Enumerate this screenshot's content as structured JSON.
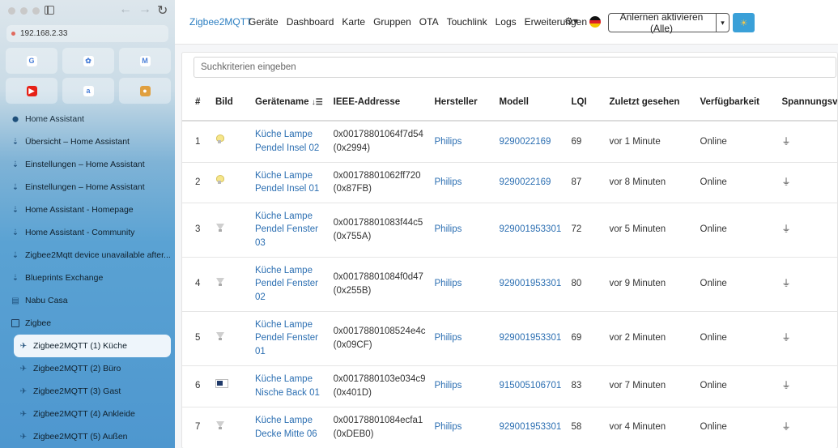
{
  "browser": {
    "url": "192.168.2.33",
    "favorites": [
      {
        "icon": "google-icon",
        "color": "#ffffff",
        "glyph": "G"
      },
      {
        "icon": "photos-icon",
        "color": "#ffffff",
        "glyph": "✿"
      },
      {
        "icon": "gmail-icon",
        "color": "#ffffff",
        "glyph": "M"
      },
      {
        "icon": "youtube-icon",
        "color": "#e62117",
        "glyph": "▶"
      },
      {
        "icon": "amazon-icon",
        "color": "#ffffff",
        "glyph": "a"
      },
      {
        "icon": "placeholder-icon",
        "color": "#e0a040",
        "glyph": "●"
      }
    ],
    "sidebar": {
      "items": [
        {
          "label": "Home Assistant",
          "icon": "home-assistant-icon",
          "kind": "header"
        },
        {
          "label": "Übersicht – Home Assistant",
          "icon": "home-assistant-icon"
        },
        {
          "label": "Einstellungen – Home Assistant",
          "icon": "home-assistant-icon"
        },
        {
          "label": "Einstellungen – Home Assistant",
          "icon": "home-assistant-icon"
        },
        {
          "label": "Home Assistant - Homepage",
          "icon": "home-assistant-icon"
        },
        {
          "label": "Home Assistant - Community",
          "icon": "home-assistant-icon"
        },
        {
          "label": "Zigbee2Mqtt device unavailable after...",
          "icon": "home-assistant-icon"
        },
        {
          "label": "Blueprints Exchange",
          "icon": "home-assistant-icon"
        },
        {
          "label": "Nabu Casa",
          "icon": "nabu-casa-icon"
        },
        {
          "label": "Zigbee",
          "icon": "folder-icon",
          "kind": "folder"
        },
        {
          "label": "Zigbee2MQTT (1) Küche",
          "icon": "zigbee2mqtt-icon",
          "kind": "sub",
          "active": true
        },
        {
          "label": "Zigbee2MQTT (2) Büro",
          "icon": "zigbee2mqtt-icon",
          "kind": "sub"
        },
        {
          "label": "Zigbee2MQTT (3) Gast",
          "icon": "zigbee2mqtt-icon",
          "kind": "sub"
        },
        {
          "label": "Zigbee2MQTT (4) Ankleide",
          "icon": "zigbee2mqtt-icon",
          "kind": "sub"
        },
        {
          "label": "Zigbee2MQTT (5) Außen",
          "icon": "zigbee2mqtt-icon",
          "kind": "sub"
        }
      ]
    }
  },
  "navbar": {
    "brand": "Zigbee2MQTT",
    "links": [
      "Geräte",
      "Dashboard",
      "Karte",
      "Gruppen",
      "OTA",
      "Touchlink",
      "Logs",
      "Erweiterungen"
    ],
    "pair_button": "Anlernen aktivieren (Alle)",
    "accent": "#2b7ec1"
  },
  "search": {
    "placeholder": "Suchkriterien eingeben",
    "value": ""
  },
  "table": {
    "headers": {
      "num": "#",
      "image": "Bild",
      "name": "Gerätename",
      "ieee": "IEEE-Addresse",
      "manufacturer": "Hersteller",
      "model": "Modell",
      "lqi": "LQI",
      "last_seen": "Zuletzt gesehen",
      "availability": "Verfügbarkeit",
      "power": "Spannungsv"
    },
    "rows": [
      {
        "num": "1",
        "image": "bulb",
        "name_lines": [
          "Küche Lampe",
          "Pendel Insel 02"
        ],
        "ieee": "0x00178801064f7d54",
        "nwk": "(0x2994)",
        "manufacturer": "Philips",
        "model": "9290022169",
        "lqi": "69",
        "last_seen": "vor 1 Minute",
        "availability": "Online"
      },
      {
        "num": "2",
        "image": "bulb",
        "name_lines": [
          "Küche Lampe",
          "Pendel Insel 01"
        ],
        "ieee": "0x00178801062ff720",
        "nwk": "(0x87FB)",
        "manufacturer": "Philips",
        "model": "9290022169",
        "lqi": "87",
        "last_seen": "vor 8 Minuten",
        "availability": "Online"
      },
      {
        "num": "3",
        "image": "spot",
        "name_lines": [
          "Küche Lampe",
          "Pendel Fenster",
          "03"
        ],
        "ieee": "0x00178801083f44c5",
        "nwk": "(0x755A)",
        "manufacturer": "Philips",
        "model": "929001953301",
        "lqi": "72",
        "last_seen": "vor 5 Minuten",
        "availability": "Online"
      },
      {
        "num": "4",
        "image": "spot",
        "name_lines": [
          "Küche Lampe",
          "Pendel Fenster",
          "02"
        ],
        "ieee": "0x00178801084f0d47",
        "nwk": "(0x255B)",
        "manufacturer": "Philips",
        "model": "929001953301",
        "lqi": "80",
        "last_seen": "vor 9 Minuten",
        "availability": "Online"
      },
      {
        "num": "5",
        "image": "spot",
        "name_lines": [
          "Küche Lampe",
          "Pendel Fenster",
          "01"
        ],
        "ieee": "0x0017880108524e4c",
        "nwk": "(0x09CF)",
        "manufacturer": "Philips",
        "model": "929001953301",
        "lqi": "69",
        "last_seen": "vor 2 Minuten",
        "availability": "Online"
      },
      {
        "num": "6",
        "image": "remote",
        "name_lines": [
          "Küche Lampe",
          "Nische Back 01"
        ],
        "ieee": "0x0017880103e034c9",
        "nwk": "(0x401D)",
        "manufacturer": "Philips",
        "model": "915005106701",
        "lqi": "83",
        "last_seen": "vor 7 Minuten",
        "availability": "Online"
      },
      {
        "num": "7",
        "image": "spot",
        "name_lines": [
          "Küche Lampe",
          "Decke Mitte 06"
        ],
        "ieee": "0x00178801084ecfa1",
        "nwk": "(0xDEB0)",
        "manufacturer": "Philips",
        "model": "929001953301",
        "lqi": "58",
        "last_seen": "vor 4 Minuten",
        "availability": "Online"
      }
    ]
  }
}
